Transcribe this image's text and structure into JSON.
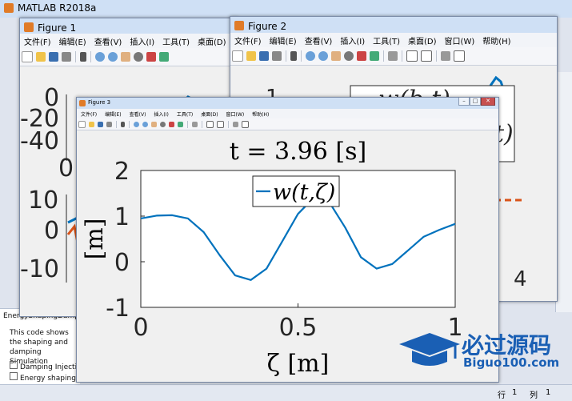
{
  "main_window": {
    "title": "MATLAB R2018a"
  },
  "figure1": {
    "title": "Figure 1",
    "menu": [
      "文件(F)",
      "编辑(E)",
      "查看(V)",
      "插入(I)",
      "工具(T)",
      "桌面(D)"
    ],
    "top_axes_yticks": [
      "0",
      "-20",
      "-40"
    ],
    "top_axes_xtick": "0",
    "bottom_axes_yticks": [
      "10",
      "0",
      "-10"
    ]
  },
  "figure2": {
    "title": "Figure 2",
    "menu": [
      "文件(F)",
      "编辑(E)",
      "查看(V)",
      "插入(I)",
      "工具(T)",
      "桌面(D)",
      "窗口(W)",
      "帮助(H)"
    ],
    "ytick": "1",
    "legend_fragment": "w(b,t)",
    "legend_fragment2": "t)",
    "xtick": "4"
  },
  "figure3": {
    "title": "Figure 3",
    "menu": [
      "文件(F)",
      "编辑(E)",
      "查看(V)",
      "插入(I)",
      "工具(T)",
      "桌面(D)",
      "窗口(W)",
      "帮助(H)"
    ],
    "plot_title": "t = 3.96 [s]",
    "ylabel": "[m]",
    "xlabel": "ζ [m]",
    "legend": "w(t,ζ)"
  },
  "chart_data": {
    "type": "line",
    "title": "t = 3.96 [s]",
    "xlabel": "ζ [m]",
    "ylabel": "[m]",
    "xlim": [
      0,
      1
    ],
    "ylim": [
      -1,
      2
    ],
    "xticks": [
      "0",
      "0.5",
      "1"
    ],
    "yticks": [
      "2",
      "1",
      "0",
      "-1"
    ],
    "legend_position": "top",
    "series": [
      {
        "name": "w(t,ζ)",
        "color": "#0072bd",
        "x": [
          0,
          0.05,
          0.1,
          0.15,
          0.2,
          0.25,
          0.3,
          0.35,
          0.4,
          0.45,
          0.5,
          0.55,
          0.6,
          0.65,
          0.7,
          0.75,
          0.8,
          0.85,
          0.9,
          0.95,
          1.0
        ],
        "y": [
          0.95,
          1.01,
          1.02,
          0.95,
          0.65,
          0.15,
          -0.3,
          -0.4,
          -0.15,
          0.45,
          1.05,
          1.4,
          1.3,
          0.75,
          0.1,
          -0.15,
          -0.05,
          0.25,
          0.55,
          0.7,
          0.83
        ]
      }
    ]
  },
  "left_panel": {
    "header": "EnergyShapingDamp",
    "description": "This code shows the shaping and damping Simulation",
    "items": [
      "Damping Injection",
      "Energy shaping"
    ]
  },
  "status_bar": {
    "row_label": "行",
    "row_value": "1",
    "col_label": "列",
    "col_value": "1"
  },
  "watermark": {
    "text_cn": "必过源码",
    "text_en": "Biguo100.com"
  },
  "colors": {
    "matlab_blue": "#0072bd",
    "matlab_orange": "#d95319",
    "titlebar": "#cfe0f5"
  }
}
